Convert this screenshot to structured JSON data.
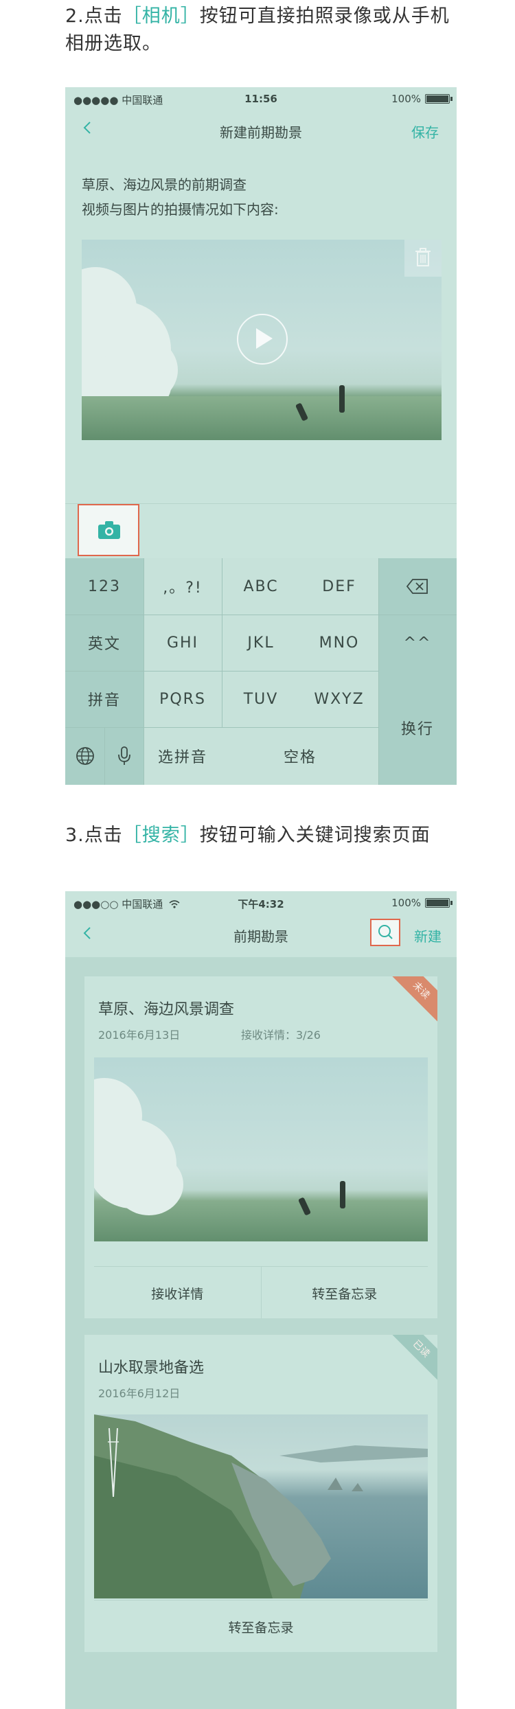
{
  "step2": {
    "prefix": "2.点击",
    "highlight": "［相机］",
    "suffix": "按钮可直接拍照录像或从手机",
    "line2": "相册选取。"
  },
  "step3": {
    "prefix": "3.点击",
    "highlight": "［搜索］",
    "suffix": "按钮可输入关键词搜索页面"
  },
  "phone1": {
    "status": {
      "carrier": "●●●●● 中国联通",
      "time": "11:56",
      "battery": "100%"
    },
    "nav": {
      "title": "新建前期勘景",
      "save": "保存"
    },
    "body_line1": "草原、海边风景的前期调查",
    "body_line2": "视频与图片的拍摄情况如下内容:",
    "keyboard": {
      "k123": "123",
      "punct": ",。?!",
      "abc": "ABC",
      "def": "DEF",
      "en": "英文",
      "ghi": "GHI",
      "jkl": "JKL",
      "mno": "MNO",
      "emoji": "^^",
      "pinyin": "拼音",
      "pqrs": "PQRS",
      "tuv": "TUV",
      "wxyz": "WXYZ",
      "enter": "换行",
      "select": "选拼音",
      "space": "空格"
    }
  },
  "phone2": {
    "status": {
      "carrier": "●●●○○ 中国联通",
      "time": "下午4:32",
      "battery": "100%"
    },
    "nav": {
      "title": "前期勘景",
      "new": "新建"
    },
    "cards": [
      {
        "title": "草原、海边风景调查",
        "date": "2016年6月13日",
        "info": "接收详情：3/26",
        "badge": "未读",
        "actions": [
          "接收详情",
          "转至备忘录"
        ]
      },
      {
        "title": "山水取景地备选",
        "date": "2016年6月12日",
        "badge": "已读",
        "actions": [
          "转至备忘录"
        ]
      }
    ]
  },
  "colors": {
    "accent": "#33b3a5",
    "highlight_border": "#e0674c",
    "badge_unread": "#d98a6c",
    "badge_read": "#9fc9bf"
  }
}
